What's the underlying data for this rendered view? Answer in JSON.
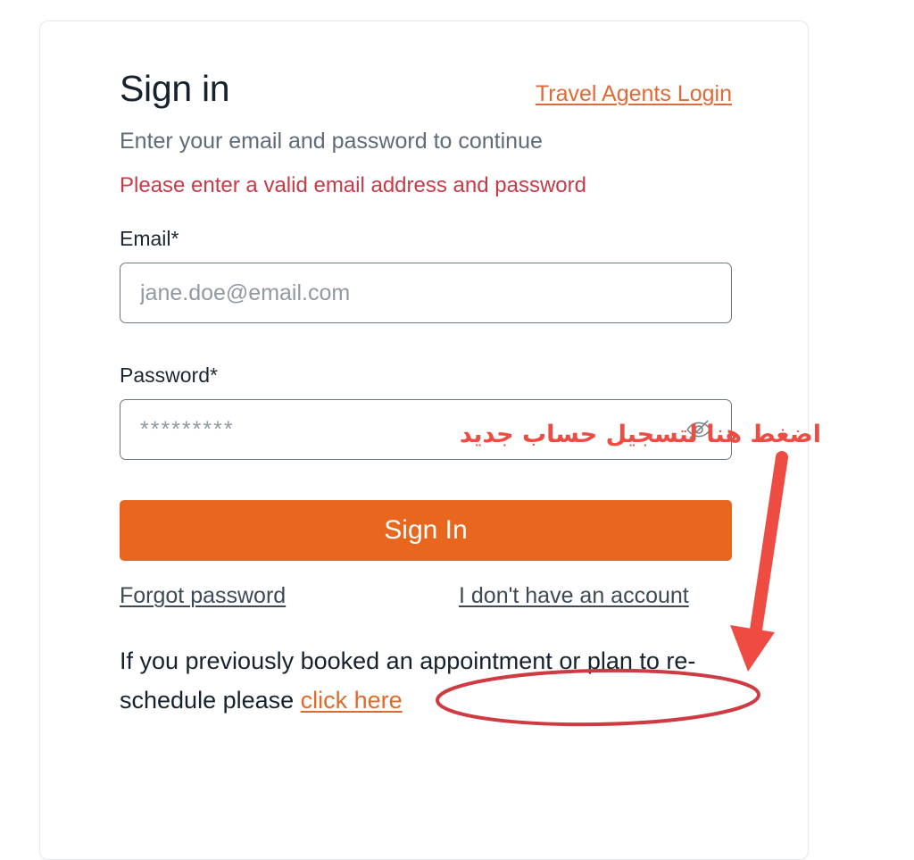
{
  "card": {
    "title": "Sign in",
    "travel_agents_link": "Travel Agents Login",
    "subtitle": "Enter your email and password to continue",
    "error_message": "Please enter a valid email address and password"
  },
  "form": {
    "email": {
      "label": "Email*",
      "placeholder": "jane.doe@email.com",
      "value": ""
    },
    "password": {
      "label": "Password*",
      "placeholder": "*********",
      "value": "",
      "toggle_icon": "eye-slash-icon"
    },
    "submit_label": "Sign In"
  },
  "links": {
    "forgot_password": "Forgot password",
    "no_account": "I don't have an account",
    "footer_text_before": "If you previously booked an appointment or plan to re-schedule please ",
    "footer_link": "click here"
  },
  "annotations": {
    "arabic_note": "اضغط هنا لتسجيل حساب جديد",
    "arrow": "red-arrow-annotation",
    "ellipse": "red-ellipse-annotation"
  },
  "colors": {
    "primary_orange": "#e8661d",
    "link_orange": "#dd6b38",
    "error_red": "#c63b48",
    "annotation_red": "#ee4b43",
    "title_navy": "#16222e",
    "subtitle_gray": "#5f6b78",
    "input_border": "#6e7880",
    "card_border": "#e6e8ea"
  }
}
